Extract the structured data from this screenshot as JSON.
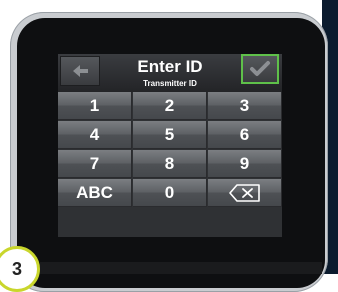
{
  "header": {
    "title": "Enter ID",
    "subtitle": "Transmitter ID",
    "back_icon": "left-arrow-icon",
    "ok_icon": "checkmark-icon"
  },
  "keypad": {
    "keys": [
      {
        "label": "1",
        "name": "key-1"
      },
      {
        "label": "2",
        "name": "key-2"
      },
      {
        "label": "3",
        "name": "key-3"
      },
      {
        "label": "4",
        "name": "key-4"
      },
      {
        "label": "5",
        "name": "key-5"
      },
      {
        "label": "6",
        "name": "key-6"
      },
      {
        "label": "7",
        "name": "key-7"
      },
      {
        "label": "8",
        "name": "key-8"
      },
      {
        "label": "9",
        "name": "key-9"
      },
      {
        "label": "ABC",
        "name": "key-abc"
      },
      {
        "label": "0",
        "name": "key-0"
      },
      {
        "label": "",
        "name": "key-backspace",
        "icon": "backspace-icon"
      }
    ]
  },
  "step_badge": {
    "number": "3"
  },
  "colors": {
    "ok_border": "#5fc14a",
    "badge_ring": "#c9d62c",
    "screen_bg": "#2f3134"
  }
}
